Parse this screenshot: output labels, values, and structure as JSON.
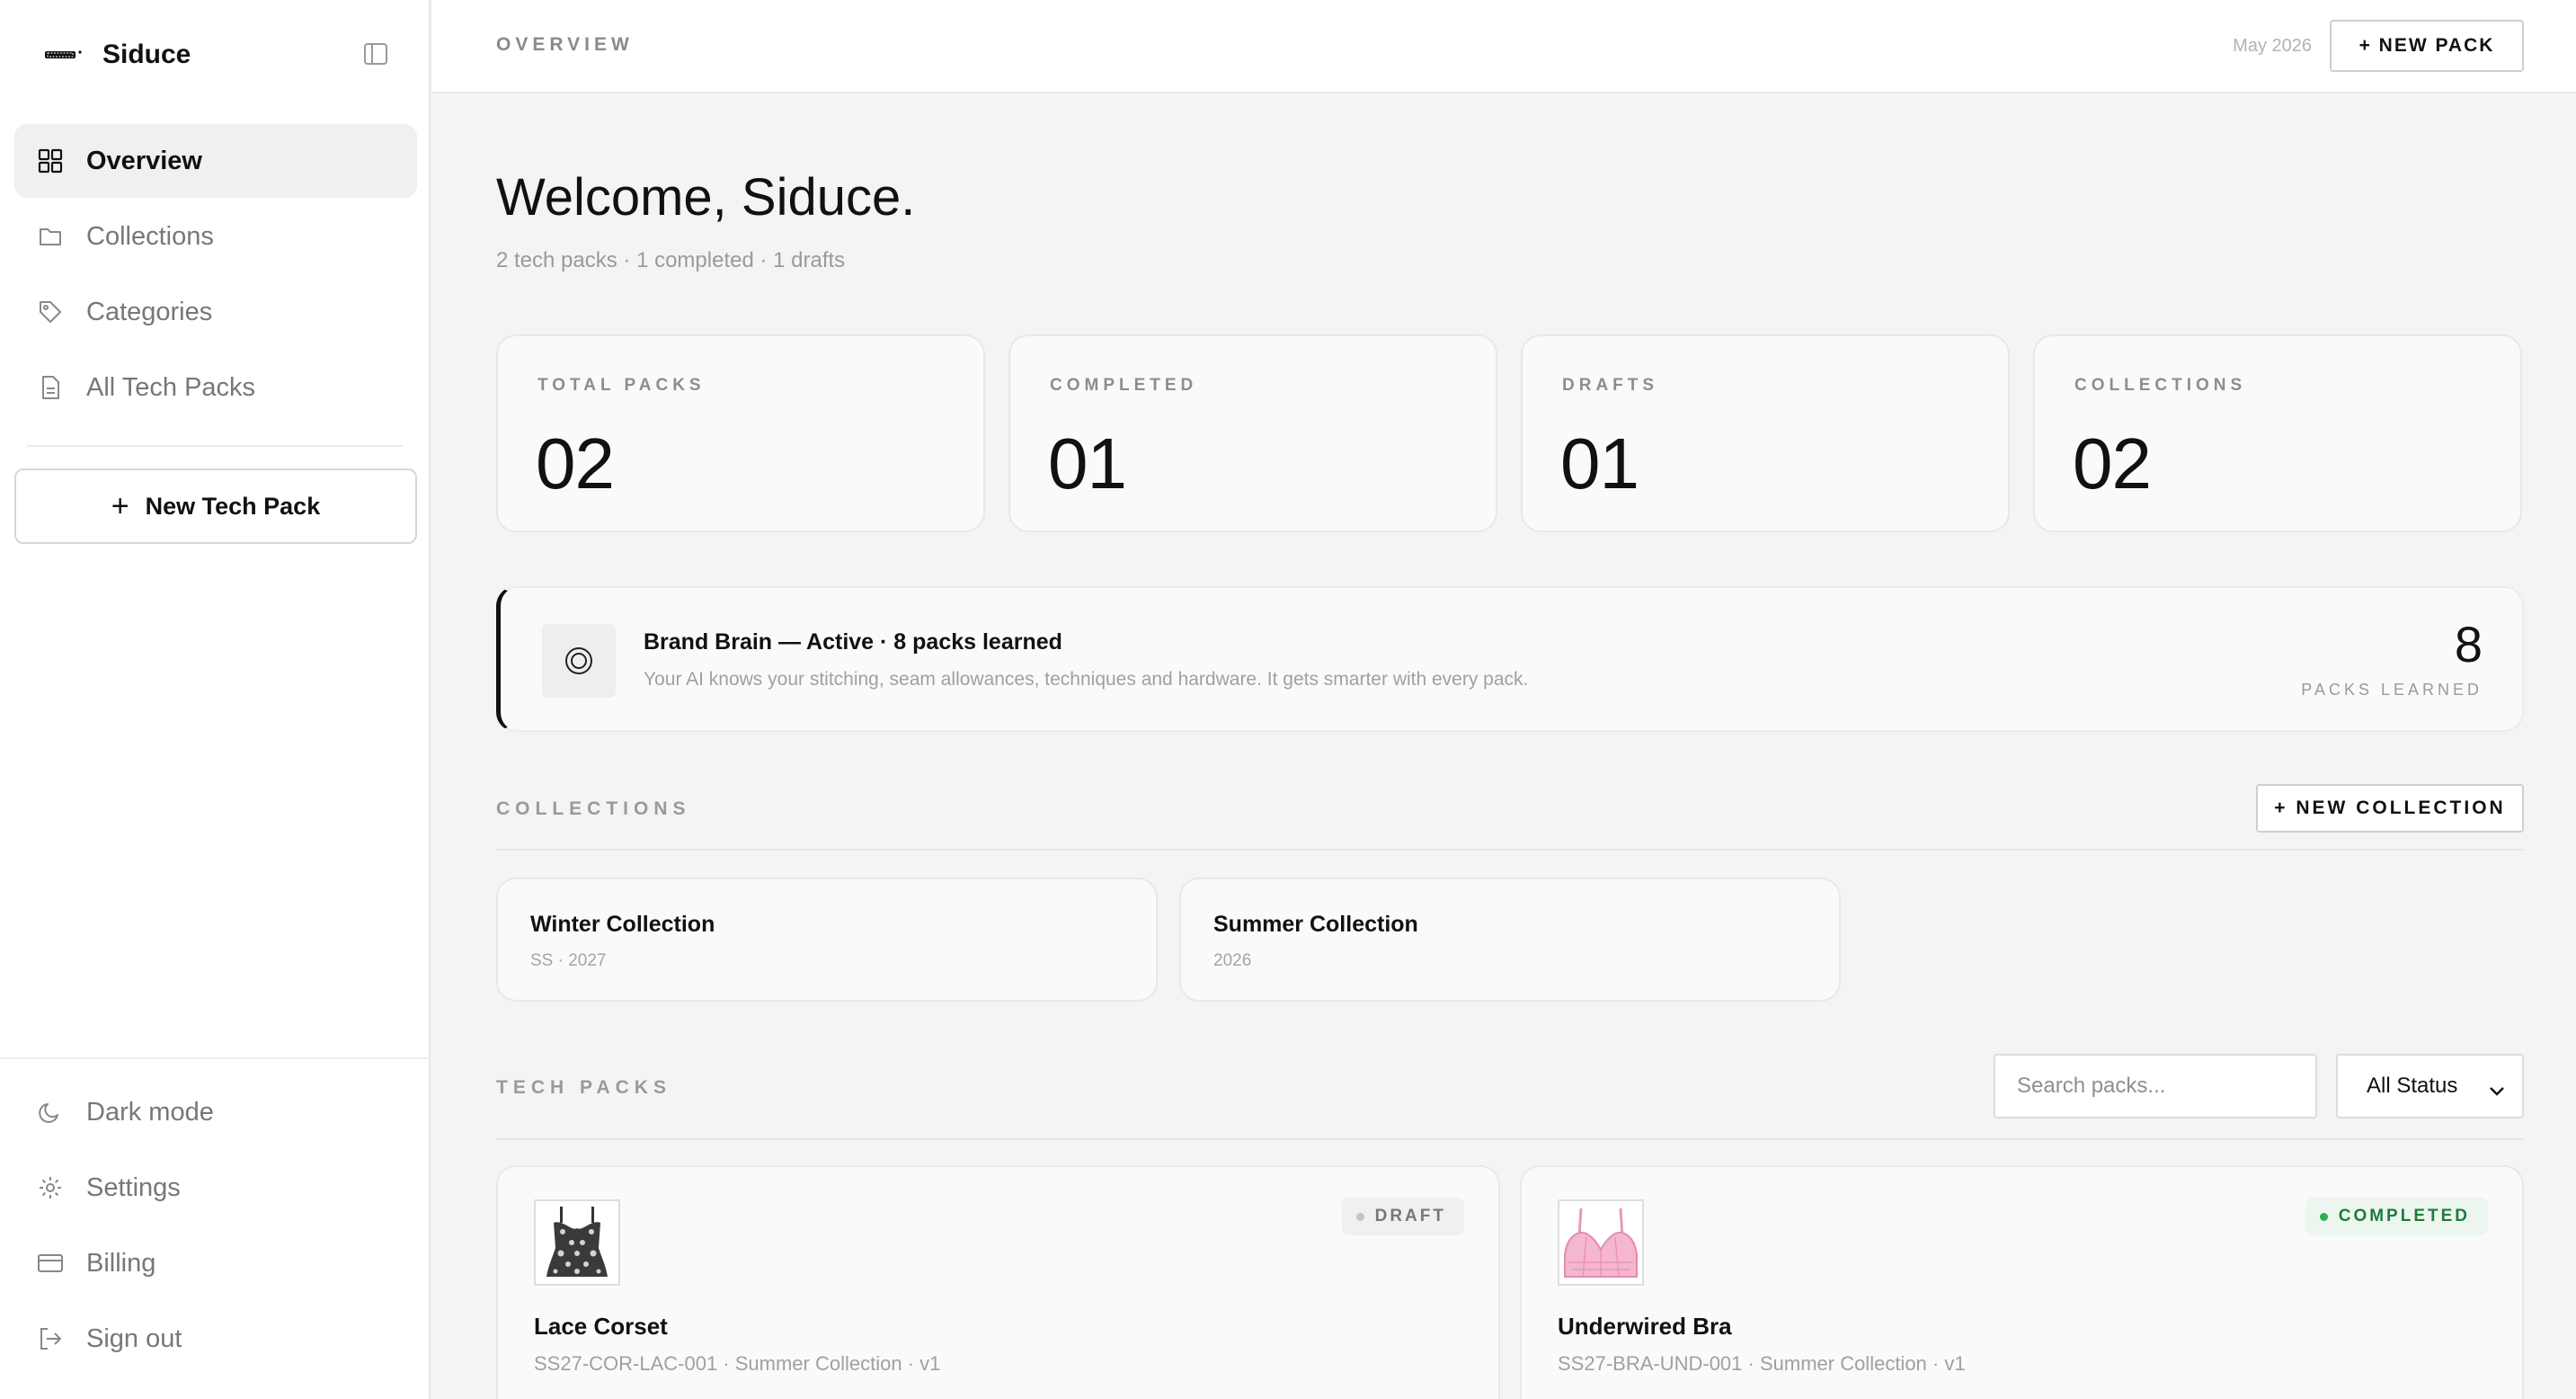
{
  "sidebar": {
    "brand": "Siduce",
    "nav": [
      {
        "label": "Overview",
        "icon": "grid-icon",
        "active": true
      },
      {
        "label": "Collections",
        "icon": "folder-icon",
        "active": false
      },
      {
        "label": "Categories",
        "icon": "tag-icon",
        "active": false
      },
      {
        "label": "All Tech Packs",
        "icon": "document-icon",
        "active": false
      }
    ],
    "new_pack_label": "New Tech Pack",
    "bottom": [
      {
        "label": "Dark mode",
        "icon": "moon-icon"
      },
      {
        "label": "Settings",
        "icon": "gear-icon"
      },
      {
        "label": "Billing",
        "icon": "credit-card-icon"
      },
      {
        "label": "Sign out",
        "icon": "sign-out-icon"
      }
    ]
  },
  "topbar": {
    "title": "OVERVIEW",
    "date": "May 2026",
    "new_pack_button": "+ NEW PACK"
  },
  "welcome": {
    "title": "Welcome, Siduce.",
    "summary": "2 tech packs · 1 completed · 1 drafts"
  },
  "stats": [
    {
      "label": "TOTAL PACKS",
      "value": "02"
    },
    {
      "label": "COMPLETED",
      "value": "01"
    },
    {
      "label": "DRAFTS",
      "value": "01"
    },
    {
      "label": "COLLECTIONS",
      "value": "02"
    }
  ],
  "brand_brain": {
    "title": "Brand Brain — Active · 8 packs learned",
    "description": "Your AI knows your stitching, seam allowances, techniques and hardware. It gets smarter with every pack.",
    "count": "8",
    "count_label": "PACKS LEARNED",
    "icon": "target-icon"
  },
  "collections": {
    "title": "COLLECTIONS",
    "new_button": "+ NEW COLLECTION",
    "items": [
      {
        "name": "Winter Collection",
        "meta": "SS · 2027"
      },
      {
        "name": "Summer Collection",
        "meta": "2026"
      }
    ]
  },
  "tech_packs": {
    "title": "TECH PACKS",
    "search_placeholder": "Search packs...",
    "status_filter": "All Status",
    "items": [
      {
        "name": "Lace Corset",
        "meta": "SS27-COR-LAC-001 · Summer Collection · v1",
        "status": "DRAFT",
        "thumbnail": "lace-corset"
      },
      {
        "name": "Underwired Bra",
        "meta": "SS27-BRA-UND-001 · Summer Collection · v1",
        "status": "COMPLETED",
        "thumbnail": "underwired-bra"
      }
    ]
  },
  "colors": {
    "accent": "#111111",
    "completed": "#2bb24f",
    "draft": "#c2c2c2"
  }
}
